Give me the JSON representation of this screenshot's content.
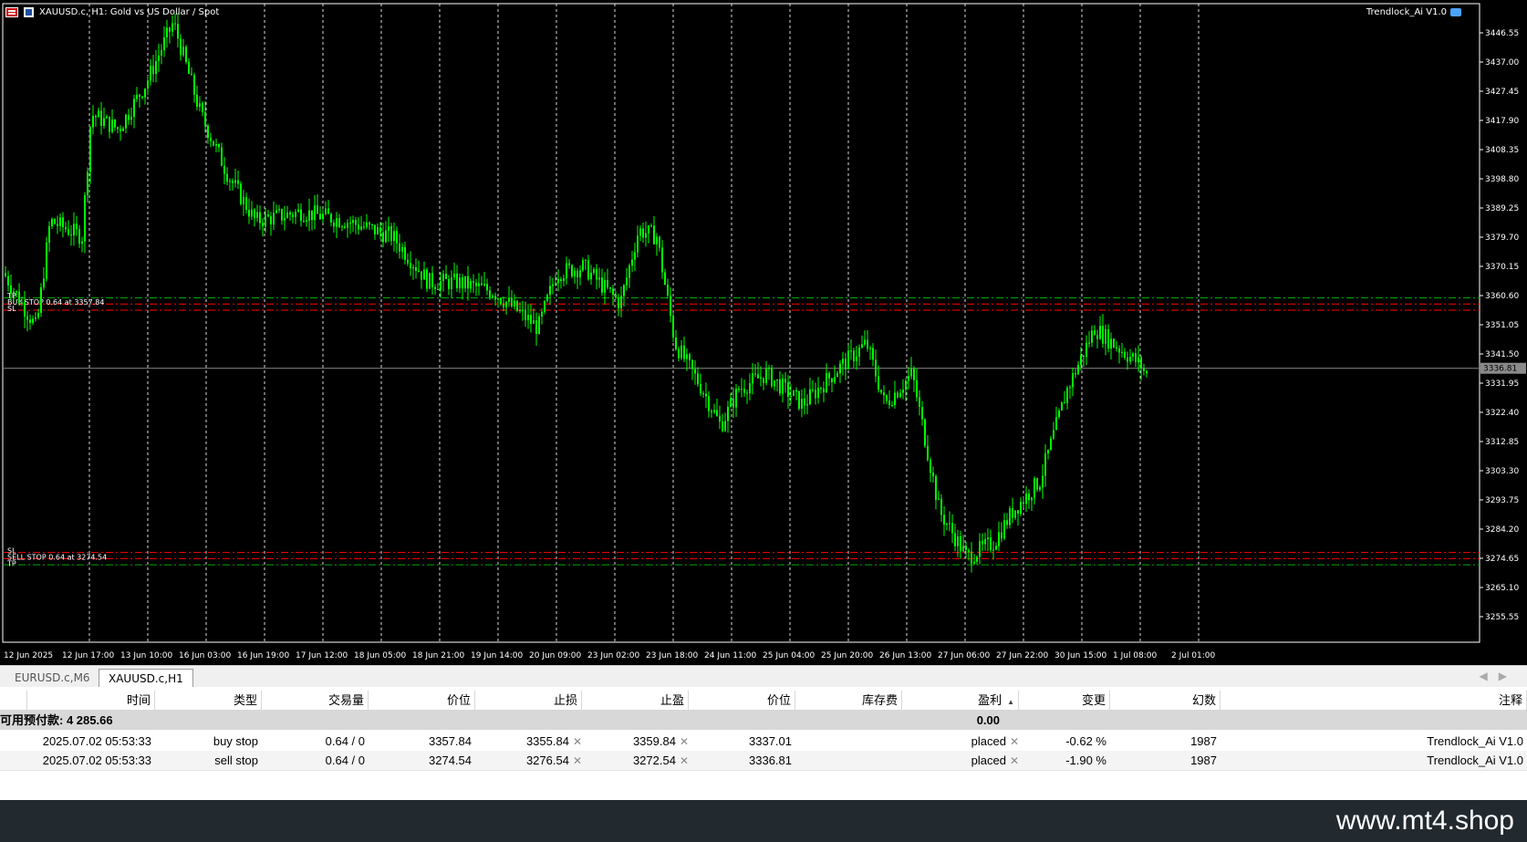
{
  "chart": {
    "header_title": "XAUUSD.c, H1:  Gold vs US Dollar / Spot",
    "ea_name": "Trendlock_Ai V1.0",
    "current_price": "3336.81",
    "price_labels": [
      "3446.55",
      "3437.00",
      "3427.45",
      "3417.90",
      "3408.35",
      "3398.80",
      "3389.25",
      "3379.70",
      "3370.15",
      "3360.60",
      "3351.05",
      "3341.50",
      "3331.95",
      "3322.40",
      "3312.85",
      "3303.30",
      "3293.75",
      "3284.20",
      "3274.65",
      "3265.10",
      "3255.55"
    ],
    "time_labels": [
      "12 Jun 2025",
      "12 Jun 17:00",
      "13 Jun 10:00",
      "16 Jun 03:00",
      "16 Jun 19:00",
      "17 Jun 12:00",
      "18 Jun 05:00",
      "18 Jun 21:00",
      "19 Jun 14:00",
      "20 Jun 09:00",
      "23 Jun 02:00",
      "23 Jun 18:00",
      "24 Jun 11:00",
      "25 Jun 04:00",
      "25 Jun 20:00",
      "26 Jun 13:00",
      "27 Jun 06:00",
      "27 Jun 22:00",
      "30 Jun 15:00",
      "1 Jul 08:00",
      "2 Jul 01:00"
    ],
    "buy_order_label": "BUY STOP 0.64 at 3357.84",
    "sell_order_label": "SELL STOP 0.64 at 3274.54",
    "tp_label": "TP",
    "sl_label": "SL",
    "colors": {
      "background": "#000000",
      "candle": "#00ff00",
      "grid": "#ffffff",
      "tp_line": "#00aa00",
      "sl_line": "#ff0000",
      "price_line": "#888888"
    }
  },
  "tabs": [
    {
      "label": "EURUSD.c,M6",
      "active": false
    },
    {
      "label": "XAUUSD.c,H1",
      "active": true
    }
  ],
  "table": {
    "headers": [
      "时间",
      "类型",
      "交易量",
      "价位",
      "止损",
      "止盈",
      "价位",
      "库存费",
      "盈利",
      "变更",
      "幻数",
      "注释"
    ],
    "summary": {
      "label": "可用预付款: 4 285.66",
      "profit": "0.00"
    },
    "rows": [
      {
        "time": "2025.07.02 05:53:33",
        "type": "buy stop",
        "volume": "0.64 / 0",
        "price": "3357.84",
        "sl": "3355.84",
        "tp": "3359.84",
        "current": "3337.01",
        "swap": "",
        "profit": "placed",
        "change": "-0.62 %",
        "magic": "1987",
        "comment": "Trendlock_Ai V1.0"
      },
      {
        "time": "2025.07.02 05:53:33",
        "type": "sell stop",
        "volume": "0.64 / 0",
        "price": "3274.54",
        "sl": "3276.54",
        "tp": "3272.54",
        "current": "3336.81",
        "swap": "",
        "profit": "placed",
        "change": "-1.90 %",
        "magic": "1987",
        "comment": "Trendlock_Ai V1.0"
      }
    ]
  },
  "footer": {
    "text": "www.mt4.shop"
  }
}
